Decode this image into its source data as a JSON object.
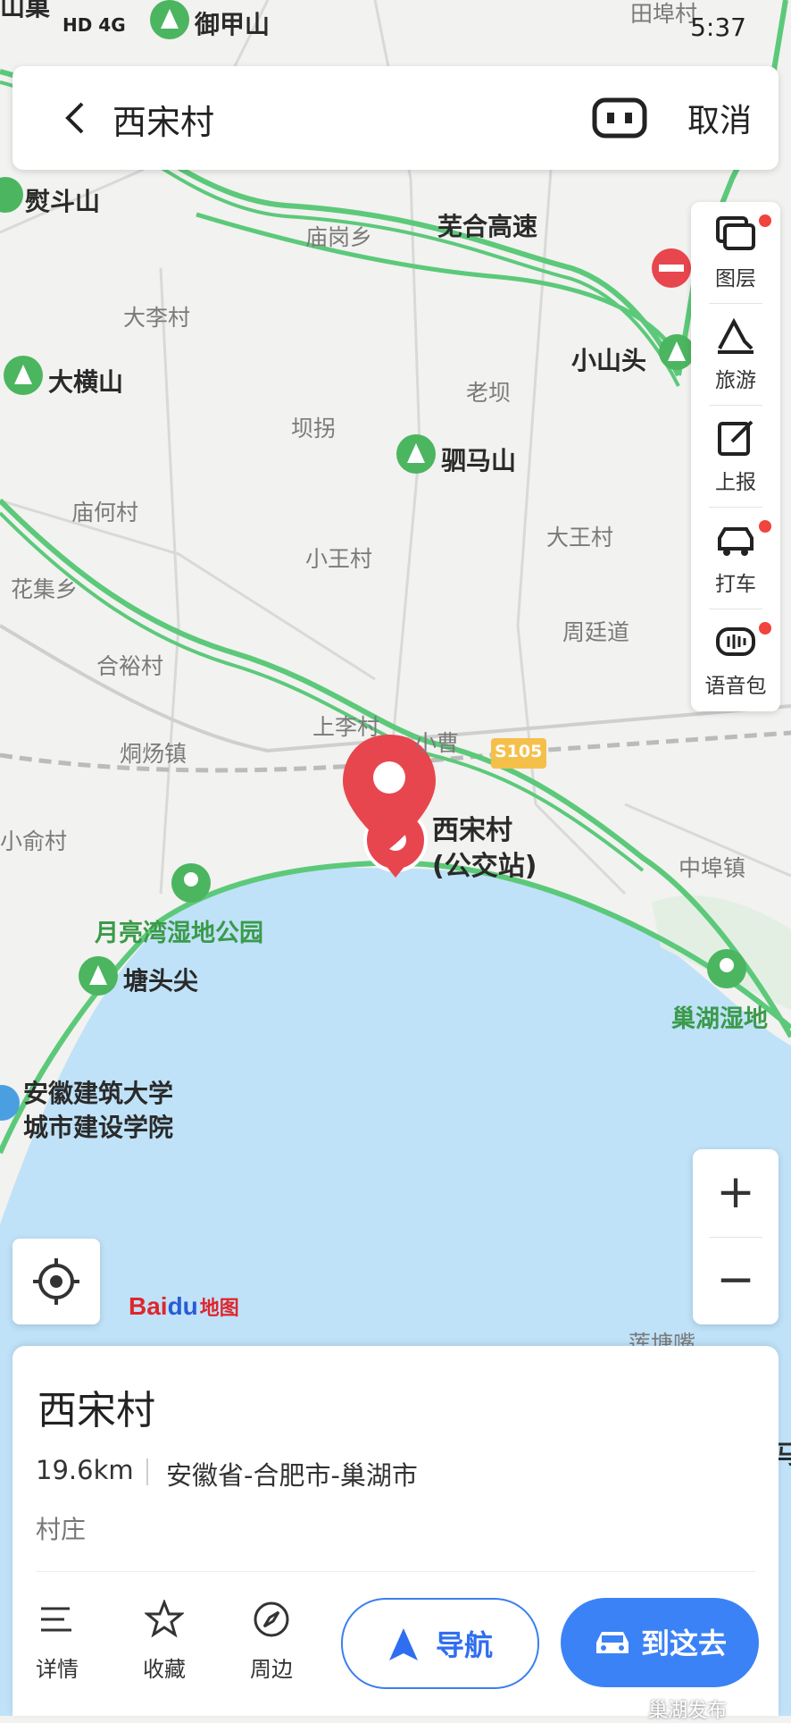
{
  "status_bar": {
    "left_text": "HD 4G",
    "time": "5:37"
  },
  "search_bar": {
    "back_icon": "chevron-left-icon",
    "query": "西宋村",
    "voice_icon": "voice-icon",
    "cancel_label": "取消"
  },
  "toolbar": {
    "items": [
      {
        "label": "图层",
        "icon": "layers-icon",
        "badge": true
      },
      {
        "label": "旅游",
        "icon": "travel-icon",
        "badge": false
      },
      {
        "label": "上报",
        "icon": "report-icon",
        "badge": false
      },
      {
        "label": "打车",
        "icon": "taxi-icon",
        "badge": true
      },
      {
        "label": "语音包",
        "icon": "voice-pack-icon",
        "badge": true
      }
    ]
  },
  "map": {
    "labels": {
      "top_left_mountain": "御甲山",
      "top_edge_a": "山巢",
      "top_edge_b": "田埠村",
      "douShan": "熨斗山",
      "highway": "芜合高速",
      "miaogang": "庙岗乡",
      "daLi": "大李村",
      "xiaoShanTou": "小山头",
      "daHeng": "大横山",
      "laoBa": "老坝",
      "baGuai": "坝拐",
      "siMa": "驷马山",
      "miaoHe": "庙何村",
      "daWang": "大王村",
      "xiaoWang": "小王村",
      "huaJi": "花集乡",
      "zhouTing": "周廷道",
      "heYu": "合裕村",
      "shangLi": "上李村",
      "xiaoCao": "小曹",
      "tongYang": "烔炀镇",
      "road_badge": "S105",
      "poi_name_line1": "西宋村",
      "poi_name_line2": "(公交站)",
      "xiaoYu": "小俞村",
      "zhongMiao": "中埠镇",
      "yueLiangWan": "月亮湾湿地公园",
      "tangTou": "塘头尖",
      "chaoHuWetland": "巢湖湿地",
      "uni_line1": "安徽建筑大学",
      "uni_line2": "城市建设学院",
      "lianTang": "莲塘嘴",
      "edge_char": "马"
    }
  },
  "zoom": {
    "in": "+",
    "out": "−"
  },
  "locate_icon": "locate-icon",
  "logo": {
    "bai": "Bai",
    "du": "du",
    "cn": "地图"
  },
  "card": {
    "name": "西宋村",
    "distance": "19.6km",
    "address": "安徽省-合肥市-巢湖市",
    "category": "村庄",
    "actions": [
      {
        "label": "详情",
        "icon": "list-icon"
      },
      {
        "label": "收藏",
        "icon": "star-icon"
      },
      {
        "label": "周边",
        "icon": "compass-icon"
      }
    ],
    "nav_label": "导航",
    "go_label": "到这去"
  },
  "watermark": "巢湖发布",
  "colors": {
    "road_green": "#5cc97a",
    "lake": "#bfe2f8",
    "pin_red": "#e8464e",
    "primary_blue": "#3b82f6"
  }
}
